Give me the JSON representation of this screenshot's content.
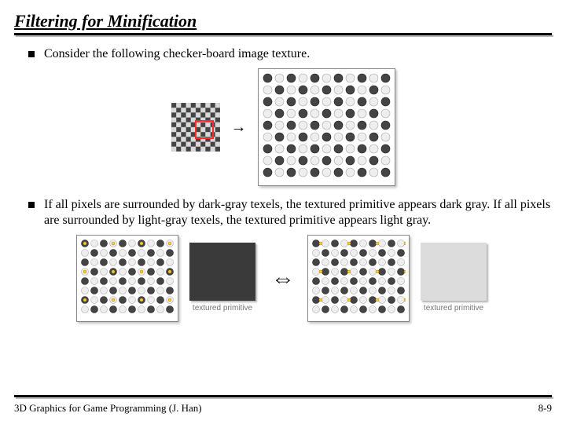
{
  "title": "Filtering for Minification",
  "bullets": {
    "b1": "Consider the following checker-board image texture.",
    "b2": "If all pixels are surrounded by dark-gray texels, the textured primitive appears dark gray. If all pixels are surrounded by light-gray texels, the textured primitive appears light gray."
  },
  "labels": {
    "textured_primitive": "textured primitive",
    "arrow_right": "→",
    "arrow_both": "⇔"
  },
  "colors": {
    "dark_texel": "#444444",
    "light_texel": "#d9d9d9",
    "pixel_marker": "#ffcc33",
    "dark_primitive": "#3a3a3a",
    "light_primitive": "#dcdcdc",
    "red": "#ff2a2a"
  },
  "footer": {
    "left": "3D Graphics for Game Programming (J. Han)",
    "right": "8-9"
  }
}
